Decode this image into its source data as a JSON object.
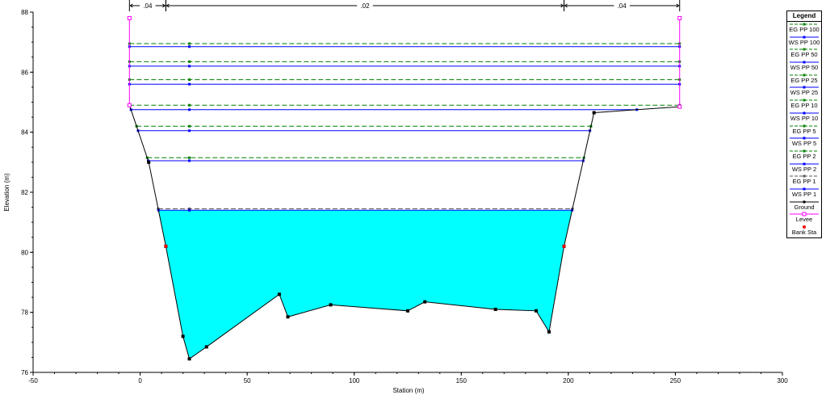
{
  "chart_data": {
    "type": "line",
    "title": "",
    "xlabel": "Station (m)",
    "ylabel": "Elevation (m)",
    "xlim": [
      -50,
      300
    ],
    "ylim": [
      76,
      88
    ],
    "xticks": [
      -50,
      0,
      50,
      100,
      150,
      200,
      250,
      300
    ],
    "yticks": [
      76,
      78,
      80,
      82,
      84,
      86,
      88
    ],
    "grid": false,
    "legend_position": "right",
    "legend_title": "Legend",
    "ground": [
      [
        -5,
        84.9
      ],
      [
        4,
        83.0
      ],
      [
        12,
        80.2
      ],
      [
        20,
        77.2
      ],
      [
        23,
        76.45
      ],
      [
        31,
        76.85
      ],
      [
        65,
        78.6
      ],
      [
        69,
        77.85
      ],
      [
        89,
        78.25
      ],
      [
        125,
        78.05
      ],
      [
        133,
        78.35
      ],
      [
        166,
        78.1
      ],
      [
        185,
        78.05
      ],
      [
        191,
        77.35
      ],
      [
        198,
        80.2
      ],
      [
        212,
        84.65
      ],
      [
        252,
        84.85
      ]
    ],
    "levee": [
      {
        "station": -5,
        "from": 84.9,
        "to": 87.8
      },
      {
        "station": 252,
        "from": 84.85,
        "to": 87.8
      }
    ],
    "bank_stations": [
      [
        12,
        80.2
      ],
      [
        198,
        80.2
      ]
    ],
    "mannings": [
      {
        "x1": -5,
        "x2": 12,
        "label": ".04"
      },
      {
        "x1": 12,
        "x2": 198,
        "label": ".02"
      },
      {
        "x1": 198,
        "x2": 252,
        "label": ".04"
      }
    ],
    "series": [
      {
        "name": "EG PP 100",
        "kind": "EG",
        "elevation": 86.95,
        "color": "#008000"
      },
      {
        "name": "WS PP 100",
        "kind": "WS",
        "elevation": 86.85,
        "color": "#0000ff"
      },
      {
        "name": "EG PP 50",
        "kind": "EG",
        "elevation": 86.35,
        "color": "#008000"
      },
      {
        "name": "WS PP 50",
        "kind": "WS",
        "elevation": 86.2,
        "color": "#0000ff"
      },
      {
        "name": "EG PP 25",
        "kind": "EG",
        "elevation": 85.75,
        "color": "#008000"
      },
      {
        "name": "WS PP 25",
        "kind": "WS",
        "elevation": 85.6,
        "color": "#0000ff"
      },
      {
        "name": "EG PP 10",
        "kind": "EG",
        "elevation": 84.9,
        "color": "#008000"
      },
      {
        "name": "WS PP 10",
        "kind": "WS",
        "elevation": 84.75,
        "color": "#0000ff"
      },
      {
        "name": "EG PP 5",
        "kind": "EG",
        "elevation": 84.2,
        "color": "#008000"
      },
      {
        "name": "WS PP 5",
        "kind": "WS",
        "elevation": 84.05,
        "color": "#0000ff"
      },
      {
        "name": "EG PP 2",
        "kind": "EG",
        "elevation": 83.15,
        "color": "#008000"
      },
      {
        "name": "WS PP 2",
        "kind": "WS",
        "elevation": 83.05,
        "color": "#0000ff"
      },
      {
        "name": "EG PP 1",
        "kind": "EG",
        "elevation": 81.45,
        "color": "#555555"
      },
      {
        "name": "WS PP 1",
        "kind": "WS",
        "elevation": 81.4,
        "color": "#0000ff",
        "fill": "#00ffff"
      }
    ],
    "legend_extra": [
      {
        "name": "Ground",
        "color": "#000000"
      },
      {
        "name": "Levee",
        "color": "#ff00ff"
      },
      {
        "name": "Bank Sta",
        "color": "#ff0000"
      }
    ]
  }
}
